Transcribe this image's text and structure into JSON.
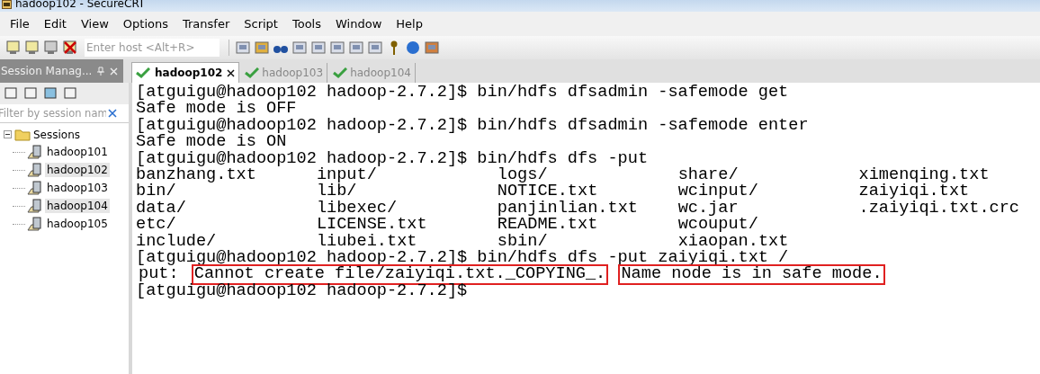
{
  "window": {
    "title": "hadoop102 - SecureCRT"
  },
  "menu": [
    "File",
    "Edit",
    "View",
    "Options",
    "Transfer",
    "Script",
    "Tools",
    "Window",
    "Help"
  ],
  "toolbar": {
    "host_field": {
      "placeholder": "Enter host <Alt+R>"
    }
  },
  "session_manager": {
    "title": "Session Manag...",
    "filter": {
      "placeholder": "Filter by session nam"
    },
    "tree": [
      {
        "label": "Sessions",
        "expanded": true,
        "children": [
          {
            "label": "hadoop101",
            "selected": false
          },
          {
            "label": "hadoop102",
            "selected": true
          },
          {
            "label": "hadoop103",
            "selected": false
          },
          {
            "label": "hadoop104",
            "selected": true
          },
          {
            "label": "hadoop105",
            "selected": false
          }
        ]
      }
    ]
  },
  "tabs": [
    {
      "label": "hadoop102",
      "selected": true
    },
    {
      "label": "hadoop103",
      "selected": false
    },
    {
      "label": "hadoop104",
      "selected": false
    }
  ],
  "terminal": {
    "lines": [
      {
        "kind": "text",
        "text": "[atguigu@hadoop102 hadoop-2.7.2]$ bin/hdfs dfsadmin -safemode get"
      },
      {
        "kind": "text",
        "text": "Safe mode is OFF"
      },
      {
        "kind": "text",
        "text": "[atguigu@hadoop102 hadoop-2.7.2]$ bin/hdfs dfsadmin -safemode enter"
      },
      {
        "kind": "text",
        "text": "Safe mode is ON"
      },
      {
        "kind": "text",
        "text": "[atguigu@hadoop102 hadoop-2.7.2]$ bin/hdfs dfs -put"
      },
      {
        "kind": "columns",
        "cells": [
          "banzhang.txt",
          "input/",
          "logs/",
          "share/",
          "ximenqing.txt"
        ]
      },
      {
        "kind": "columns",
        "cells": [
          "bin/",
          "lib/",
          "NOTICE.txt",
          "wcinput/",
          "zaiyiqi.txt"
        ]
      },
      {
        "kind": "columns",
        "cells": [
          "data/",
          "libexec/",
          "panjinlian.txt",
          "wc.jar",
          ".zaiyiqi.txt.crc"
        ]
      },
      {
        "kind": "columns",
        "cells": [
          "etc/",
          "LICENSE.txt",
          "README.txt",
          "wcouput/"
        ]
      },
      {
        "kind": "columns",
        "cells": [
          "include/",
          "liubei.txt",
          "sbin/",
          "xiaopan.txt"
        ]
      },
      {
        "kind": "text",
        "text": "[atguigu@hadoop102 hadoop-2.7.2]$ bin/hdfs dfs -put zaiyiqi.txt /"
      },
      {
        "kind": "segments",
        "parts": [
          {
            "text": "put:",
            "boxed": false
          },
          {
            "text": "Cannot create file/zaiyiqi.txt._COPYING_.",
            "boxed": true
          },
          {
            "text": "Name node is in safe mode.",
            "boxed": true
          }
        ]
      },
      {
        "kind": "text",
        "text": "[atguigu@hadoop102 hadoop-2.7.2]$"
      }
    ]
  }
}
